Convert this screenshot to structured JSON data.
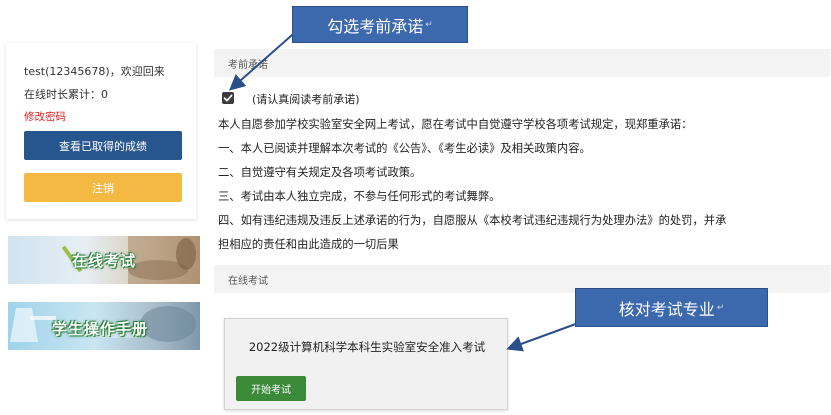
{
  "user_panel": {
    "welcome": "test(12345678)，欢迎回来",
    "online_time": "在线时长累计：0",
    "change_password": "修改密码",
    "view_scores_button": "查看已取得的成绩",
    "logout_button": "注销"
  },
  "banners": [
    {
      "label": "在线考试"
    },
    {
      "label": "学生操作手册"
    }
  ],
  "pledge": {
    "section_title": "考前承诺",
    "checkbox_label": "(请认真阅读考前承诺)",
    "checked": true,
    "lines": [
      "本人自愿参加学校实验室安全网上考试，愿在考试中自觉遵守学校各项考试规定，现郑重承诺：",
      " 一、本人已阅读并理解本次考试的《公告》、《考生必读》及相关政策内容。",
      " 二、自觉遵守有关规定及各项考试政策。",
      "三、考试由本人独立完成，不参与任何形式的考试舞弊。",
      " 四、如有违纪违规及违反上述承诺的行为，自愿服从《本校考试违纪违规行为处理办法》的处罚，并承",
      "担相应的责任和由此造成的一切后果"
    ]
  },
  "online_exam": {
    "section_title": "在线考试",
    "exam_name": "2022级计算机科学本科生实验室安全准入考试",
    "start_button": "开始考试"
  },
  "annotations": {
    "callout_pledge": "勾选考前承诺",
    "callout_major": "核对考试专业",
    "mark": "↵"
  },
  "colors": {
    "primary_blue": "#27568f",
    "logout_orange": "#f4b942",
    "start_green": "#3a8a3a",
    "callout_blue": "#3c68ad",
    "link_red": "#e02020"
  }
}
